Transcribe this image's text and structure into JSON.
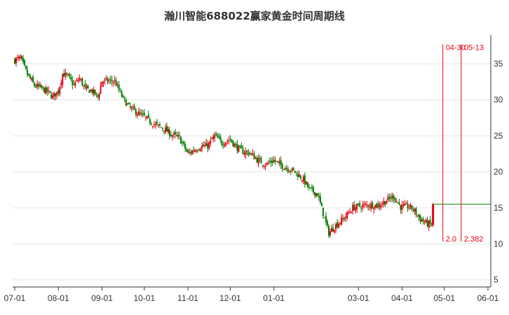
{
  "chart_data": {
    "type": "candlestick",
    "title": "瀚川智能688022赢家黄金时间周期线",
    "xlabel": "",
    "ylabel": "",
    "x_ticks": [
      "07-01",
      "08-01",
      "09-01",
      "10-01",
      "11-01",
      "12-01",
      "01-01",
      "03-01",
      "04-01",
      "05-01",
      "06-01"
    ],
    "y_ticks": [
      5,
      10,
      15,
      20,
      25,
      30,
      35
    ],
    "ylim": [
      4,
      39
    ],
    "grid": true,
    "colors": {
      "up": "#e60012",
      "down": "#008000",
      "marker": "#e60012",
      "grid": "#e6e6e6",
      "axis": "#333333"
    },
    "price_path": [
      [
        "07-01",
        35.5
      ],
      [
        "07-05",
        35.8
      ],
      [
        "07-10",
        33.5
      ],
      [
        "07-15",
        32.0
      ],
      [
        "07-20",
        31.6
      ],
      [
        "07-25",
        31.0
      ],
      [
        "07-28",
        30.4
      ],
      [
        "08-01",
        31.2
      ],
      [
        "08-04",
        33.6
      ],
      [
        "08-08",
        33.2
      ],
      [
        "08-12",
        32.0
      ],
      [
        "08-16",
        33.0
      ],
      [
        "08-20",
        31.5
      ],
      [
        "08-25",
        31.2
      ],
      [
        "08-29",
        30.4
      ],
      [
        "09-01",
        32.6
      ],
      [
        "09-05",
        32.6
      ],
      [
        "09-10",
        32.6
      ],
      [
        "09-15",
        30.5
      ],
      [
        "09-20",
        29.0
      ],
      [
        "09-26",
        28.2
      ],
      [
        "10-01",
        27.6
      ],
      [
        "10-08",
        26.6
      ],
      [
        "10-15",
        26.0
      ],
      [
        "10-20",
        25.2
      ],
      [
        "10-26",
        24.7
      ],
      [
        "11-01",
        22.5
      ],
      [
        "11-05",
        23.0
      ],
      [
        "11-10",
        23.5
      ],
      [
        "11-15",
        23.6
      ],
      [
        "11-20",
        25.0
      ],
      [
        "11-25",
        24.0
      ],
      [
        "12-01",
        24.5
      ],
      [
        "12-05",
        23.5
      ],
      [
        "12-10",
        22.8
      ],
      [
        "12-15",
        22.6
      ],
      [
        "12-20",
        21.7
      ],
      [
        "12-26",
        21.0
      ],
      [
        "01-01",
        21.6
      ],
      [
        "01-06",
        20.9
      ],
      [
        "01-11",
        20.5
      ],
      [
        "01-16",
        20.0
      ],
      [
        "01-22",
        18.9
      ],
      [
        "01-26",
        17.6
      ],
      [
        "02-01",
        16.9
      ],
      [
        "02-06",
        13.5
      ],
      [
        "02-09",
        11.5
      ],
      [
        "02-14",
        12.6
      ],
      [
        "02-20",
        13.6
      ],
      [
        "02-26",
        15.0
      ],
      [
        "03-01",
        15.2
      ],
      [
        "03-08",
        15.4
      ],
      [
        "03-15",
        15.3
      ],
      [
        "03-21",
        16.0
      ],
      [
        "03-26",
        16.6
      ],
      [
        "03-31",
        15.1
      ],
      [
        "04-05",
        15.2
      ],
      [
        "04-09",
        14.8
      ],
      [
        "04-14",
        13.4
      ],
      [
        "04-19",
        12.8
      ],
      [
        "04-22",
        12.6
      ],
      [
        "04-23",
        15.5
      ]
    ],
    "current_level": 15.5,
    "markers": [
      {
        "date": "04-30",
        "value_label": "2.0"
      },
      {
        "date": "05-13",
        "value_label": "2.382"
      }
    ]
  }
}
